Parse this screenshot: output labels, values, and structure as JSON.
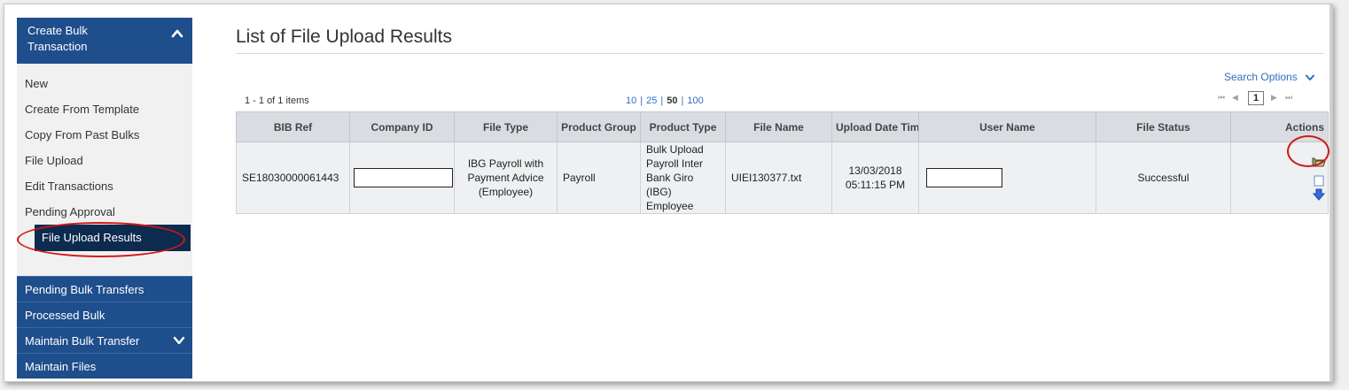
{
  "sidebar": {
    "header_label": "Create Bulk Transaction",
    "items": [
      {
        "label": "New"
      },
      {
        "label": "Create From Template"
      },
      {
        "label": "Copy From Past Bulks"
      },
      {
        "label": "File Upload"
      },
      {
        "label": "Edit Transactions"
      },
      {
        "label": "Pending Approval"
      },
      {
        "label": "File Upload Results"
      }
    ],
    "sections": [
      {
        "label": "Pending Bulk Transfers"
      },
      {
        "label": "Processed Bulk"
      },
      {
        "label": "Maintain Bulk Transfer"
      },
      {
        "label": "Maintain Files"
      }
    ]
  },
  "main": {
    "title": "List of File Upload Results",
    "search_options_label": "Search Options",
    "items_count": "1 - 1 of 1 items",
    "page_sizes": {
      "s1": "10",
      "s2": "25",
      "s3": "50",
      "s4": "100",
      "sep": "|"
    },
    "pager": {
      "first": "⏮",
      "prev": "◀",
      "current_page": "1",
      "next": "▶",
      "last": "⏭"
    },
    "table": {
      "columns": [
        "BIB Ref",
        "Company ID",
        "File Type",
        "Product Group",
        "Product Type",
        "File Name",
        "Upload Date Time",
        "User Name",
        "File Status",
        "Actions"
      ],
      "rows": [
        {
          "bib_ref": "SE18030000061443",
          "company_id": "",
          "file_type": "IBG Payroll with Payment Advice (Employee)",
          "product_group": "Payroll",
          "product_type": "Bulk Upload Payroll Inter Bank Giro (IBG) Employee",
          "file_name": "UIEI130377.txt",
          "upload_date": "13/03/2018",
          "upload_time": "05:11:15 PM",
          "user_name": "",
          "file_status": "Successful"
        }
      ]
    }
  },
  "colors": {
    "sidebar_blue": "#1f4e8c",
    "sidebar_active": "#0d2a4f",
    "link_blue": "#2f6fbf",
    "annotation_red": "#d21818"
  },
  "icons": {
    "header_collapse": "chevron-up-icon",
    "maintain_expand": "chevron-down-icon",
    "search_expand": "chevron-down-icon",
    "action_view": "folder-icon",
    "action_doc": "document-icon",
    "action_download": "download-arrow-icon"
  }
}
